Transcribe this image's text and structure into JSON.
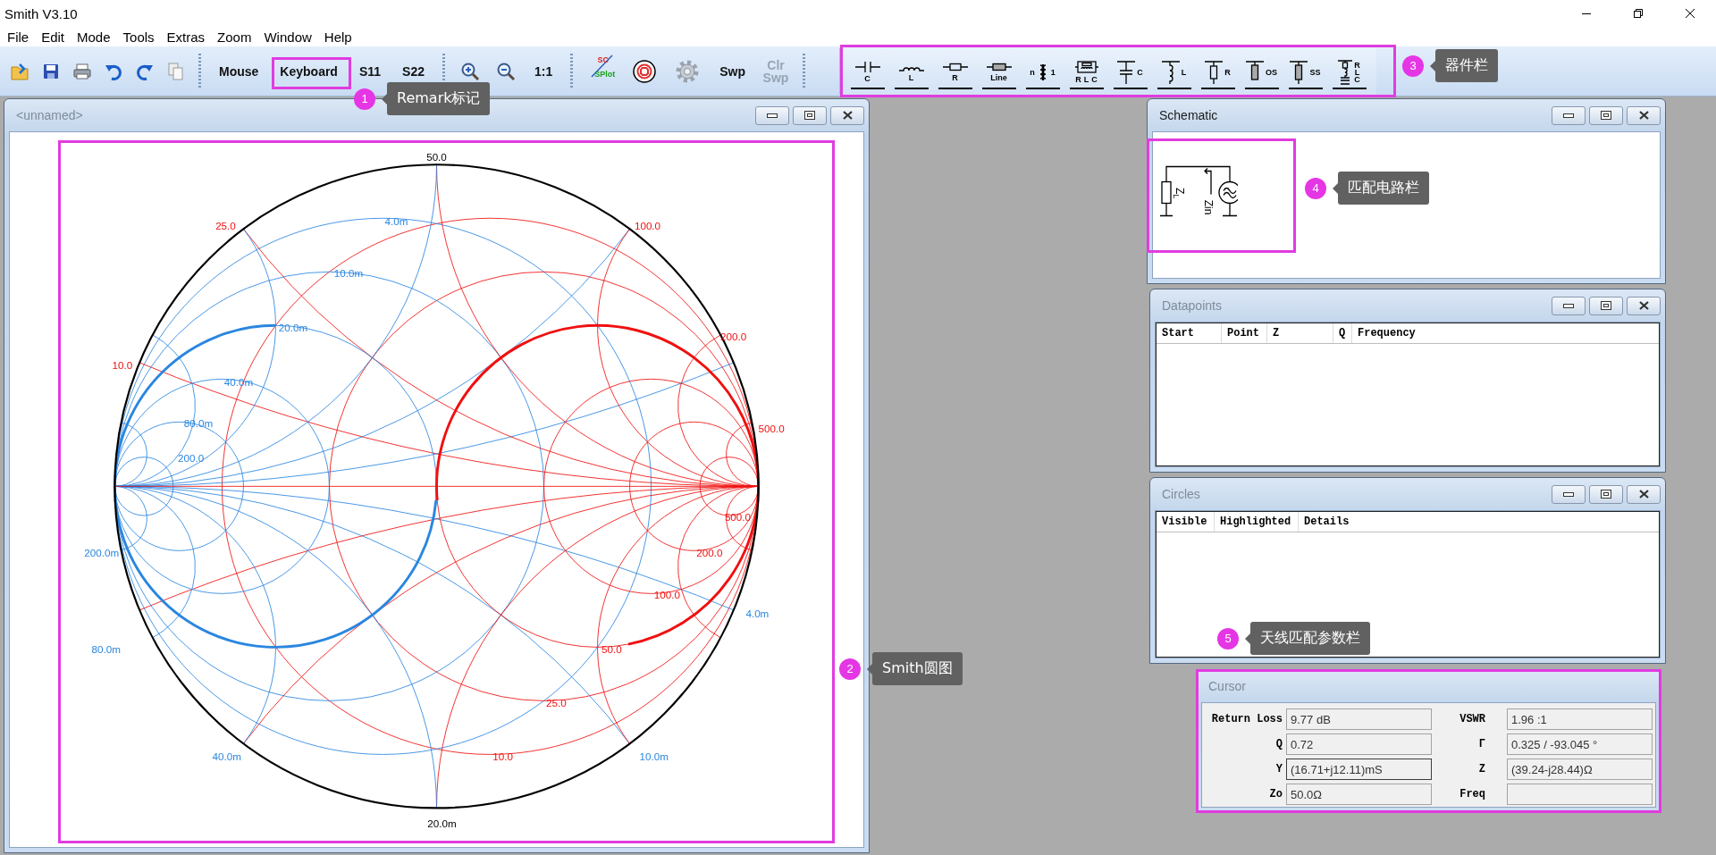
{
  "window": {
    "title": "Smith V3.10"
  },
  "menu": [
    "File",
    "Edit",
    "Mode",
    "Tools",
    "Extras",
    "Zoom",
    "Window",
    "Help"
  ],
  "toolbar": [
    {
      "kind": "open"
    },
    {
      "kind": "save"
    },
    {
      "kind": "print"
    },
    {
      "kind": "undo"
    },
    {
      "kind": "redo"
    },
    {
      "kind": "copy"
    },
    {
      "kind": "separator"
    },
    {
      "kind": "text",
      "label": "Mouse",
      "disabled": false
    },
    {
      "kind": "text",
      "label": "Keyboard",
      "disabled": false
    },
    {
      "kind": "text",
      "label": "S11",
      "disabled": false
    },
    {
      "kind": "text",
      "label": "S22",
      "disabled": false
    },
    {
      "kind": "separator"
    },
    {
      "kind": "zoom-in"
    },
    {
      "kind": "zoom-out"
    },
    {
      "kind": "text",
      "label": "1:1",
      "disabled": false
    },
    {
      "kind": "separator"
    },
    {
      "kind": "splot",
      "labels": [
        "SC",
        "SPlot"
      ]
    },
    {
      "kind": "target"
    },
    {
      "kind": "gear"
    },
    {
      "kind": "text",
      "label": "Swp",
      "disabled": false
    },
    {
      "kind": "text",
      "label": "Clr Swp",
      "disabled": true
    }
  ],
  "components": [
    {
      "kind": "series-c",
      "labels": [
        "C"
      ]
    },
    {
      "kind": "series-l",
      "labels": [
        "L"
      ]
    },
    {
      "kind": "series-r",
      "labels": [
        "R"
      ]
    },
    {
      "kind": "line",
      "labels": [
        "Line"
      ]
    },
    {
      "kind": "transformer",
      "labels": [
        "n",
        "1"
      ]
    },
    {
      "kind": "series-rlc",
      "labels": [
        "R",
        "L",
        "C"
      ]
    },
    {
      "kind": "shunt-c",
      "labels": [
        "C"
      ]
    },
    {
      "kind": "shunt-l",
      "labels": [
        "L"
      ]
    },
    {
      "kind": "shunt-r",
      "labels": [
        "R"
      ]
    },
    {
      "kind": "open-stub",
      "labels": [
        "OS"
      ]
    },
    {
      "kind": "short-stub",
      "labels": [
        "SS"
      ]
    },
    {
      "kind": "shunt-rlc",
      "labels": [
        "R",
        "L",
        "C"
      ]
    }
  ],
  "chart_window": {
    "title": "<unnamed>",
    "active": false,
    "labels": [
      {
        "text": "50.0",
        "kind": "outer"
      },
      {
        "text": "4.0m",
        "kind": "admittance"
      },
      {
        "text": "25.0",
        "kind": "impedance"
      },
      {
        "text": "100.0",
        "kind": "impedance"
      },
      {
        "text": "10.0m",
        "kind": "admittance"
      },
      {
        "text": "20.0m",
        "kind": "admittance"
      },
      {
        "text": "200.0",
        "kind": "impedance"
      },
      {
        "text": "10.0",
        "kind": "impedance"
      },
      {
        "text": "40.0m",
        "kind": "admittance"
      },
      {
        "text": "80.0m",
        "kind": "admittance"
      },
      {
        "text": "500.0",
        "kind": "impedance"
      },
      {
        "text": "200.0",
        "kind": "admittance"
      },
      {
        "text": "500.0",
        "kind": "impedance"
      },
      {
        "text": "200.0m",
        "kind": "admittance"
      },
      {
        "text": "200.0",
        "kind": "impedance"
      },
      {
        "text": "100.0",
        "kind": "impedance"
      },
      {
        "text": "4.0m",
        "kind": "admittance"
      },
      {
        "text": "50.0",
        "kind": "impedance"
      },
      {
        "text": "80.0m",
        "kind": "admittance"
      },
      {
        "text": "25.0",
        "kind": "impedance"
      },
      {
        "text": "40.0m",
        "kind": "admittance"
      },
      {
        "text": "10.0",
        "kind": "impedance"
      },
      {
        "text": "10.0m",
        "kind": "admittance"
      },
      {
        "text": "20.0m",
        "kind": "outer"
      }
    ]
  },
  "schematic_window": {
    "title": "Schematic",
    "active": true,
    "circuit": {
      "load_label": "Z$_{L}$",
      "input_label": "Zin"
    }
  },
  "datapoints_window": {
    "title": "Datapoints",
    "active": false,
    "columns": [
      "Start",
      "Point",
      "Z",
      "Q",
      "Frequency"
    ]
  },
  "circles_window": {
    "title": "Circles",
    "active": false,
    "columns": [
      "Visible",
      "Highlighted",
      "Details"
    ]
  },
  "cursor_window": {
    "title": "Cursor",
    "active": false,
    "fields": [
      {
        "label": "Return Loss",
        "value": "9.77 dB",
        "focused": false
      },
      {
        "label": "VSWR",
        "value": "1.96 :1",
        "focused": false
      },
      {
        "label": "Q",
        "value": "0.72",
        "focused": false
      },
      {
        "label": "Γ",
        "value": "0.325 / -93.045 °",
        "focused": false
      },
      {
        "label": "Y",
        "value": "(16.71+j12.11)mS",
        "focused": true
      },
      {
        "label": "Z",
        "value": "(39.24-j28.44)Ω",
        "focused": false
      },
      {
        "label": "Zo",
        "value": "50.0Ω",
        "focused": false
      },
      {
        "label": "Freq",
        "focused": false
      }
    ]
  },
  "annotations": [
    {
      "number": "1",
      "label": "Remark标记"
    },
    {
      "number": "2",
      "label": "Smith圆图"
    },
    {
      "number": "3",
      "label": "器件栏"
    },
    {
      "number": "4",
      "label": "匹配电路栏"
    },
    {
      "number": "5",
      "label": "天线匹配参数栏"
    }
  ]
}
